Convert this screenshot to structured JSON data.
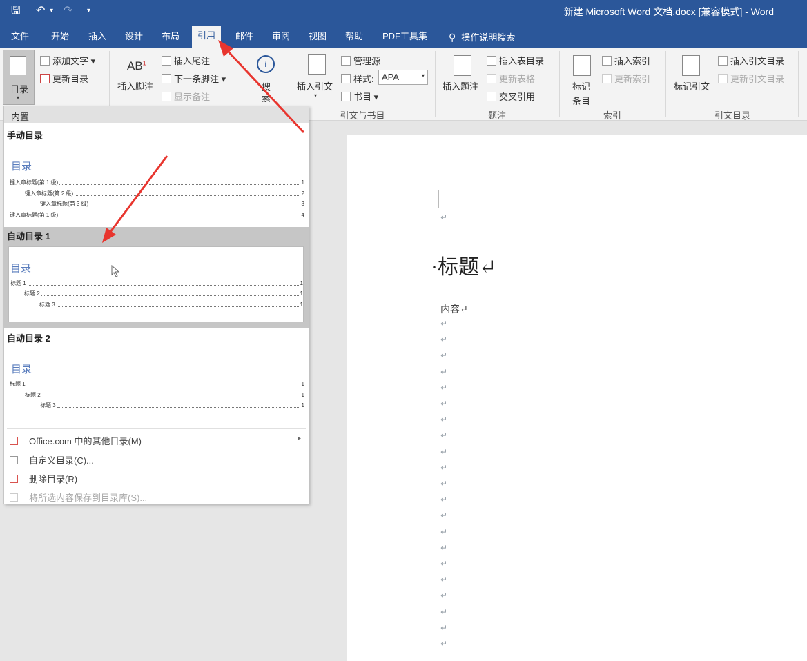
{
  "window": {
    "title": "新建 Microsoft Word 文档.docx [兼容模式] - Word",
    "quick_access": {
      "save": "🖫",
      "undo": "↶",
      "undo_dd": "▾",
      "redo": "↷",
      "customize": "▾"
    }
  },
  "ribbon_tabs": [
    "文件",
    "开始",
    "插入",
    "设计",
    "布局",
    "引用",
    "邮件",
    "审阅",
    "视图",
    "帮助",
    "PDF工具集"
  ],
  "active_tab": "引用",
  "tell_me": "操作说明搜索",
  "ribbon": {
    "toc": {
      "button": "目录",
      "add_text": "添加文字 ▾",
      "update": "更新目录"
    },
    "footnotes": {
      "insert_footnote": "插入脚注",
      "ab": "AB",
      "insert_endnote": "插入尾注",
      "next_footnote": "下一条脚注 ▾",
      "show_notes": "显示备注"
    },
    "search": {
      "label1": "搜",
      "label2": "索"
    },
    "citations": {
      "insert_citation": "插入引文",
      "manage_sources": "管理源",
      "style_label": "样式:",
      "style_value": "APA",
      "bibliography": "书目 ▾",
      "group": "引文与书目"
    },
    "captions": {
      "insert_caption": "插入题注",
      "insert_table_figures": "插入表目录",
      "update_table": "更新表格",
      "cross_ref": "交叉引用",
      "group": "题注"
    },
    "index": {
      "mark_entry1": "标记",
      "mark_entry2": "条目",
      "insert_index": "插入索引",
      "update_index": "更新索引",
      "group": "索引"
    },
    "toa": {
      "mark_citation": "标记引文",
      "insert_toa": "插入引文目录",
      "update_toa": "更新引文目录",
      "group": "引文目录"
    }
  },
  "dropdown": {
    "header": "内置",
    "manual": {
      "title": "手动目录",
      "toc_heading": "目录",
      "lines": [
        {
          "text": "键入章标题(第 1 级)",
          "page": "1"
        },
        {
          "text": "键入章标题(第 2 级)",
          "page": "2"
        },
        {
          "text": "键入章标题(第 3 级)",
          "page": "3"
        },
        {
          "text": "键入章标题(第 1 级)",
          "page": "4"
        }
      ]
    },
    "auto1": {
      "title": "自动目录 1",
      "toc_heading": "目录",
      "lines": [
        {
          "text": "标题 1",
          "page": "1"
        },
        {
          "text": "标题 2",
          "page": "1"
        },
        {
          "text": "标题 3",
          "page": "1"
        }
      ]
    },
    "auto2": {
      "title": "自动目录 2",
      "toc_heading": "目录",
      "lines": [
        {
          "text": "标题 1",
          "page": "1"
        },
        {
          "text": "标题 2",
          "page": "1"
        },
        {
          "text": "标题 3",
          "page": "1"
        }
      ]
    },
    "menu": [
      {
        "label": "Office.com 中的其他目录(M)",
        "enabled": true
      },
      {
        "label": "自定义目录(C)...",
        "enabled": true
      },
      {
        "label": "删除目录(R)",
        "enabled": true
      },
      {
        "label": "将所选内容保存到目录库(S)...",
        "enabled": false
      }
    ],
    "submenu_arrow": "▸"
  },
  "document": {
    "heading": "·标题↵",
    "content": "内容↵",
    "para_mark": "↵"
  },
  "colors": {
    "accent": "#2b579a",
    "arrow": "#e8352e"
  }
}
